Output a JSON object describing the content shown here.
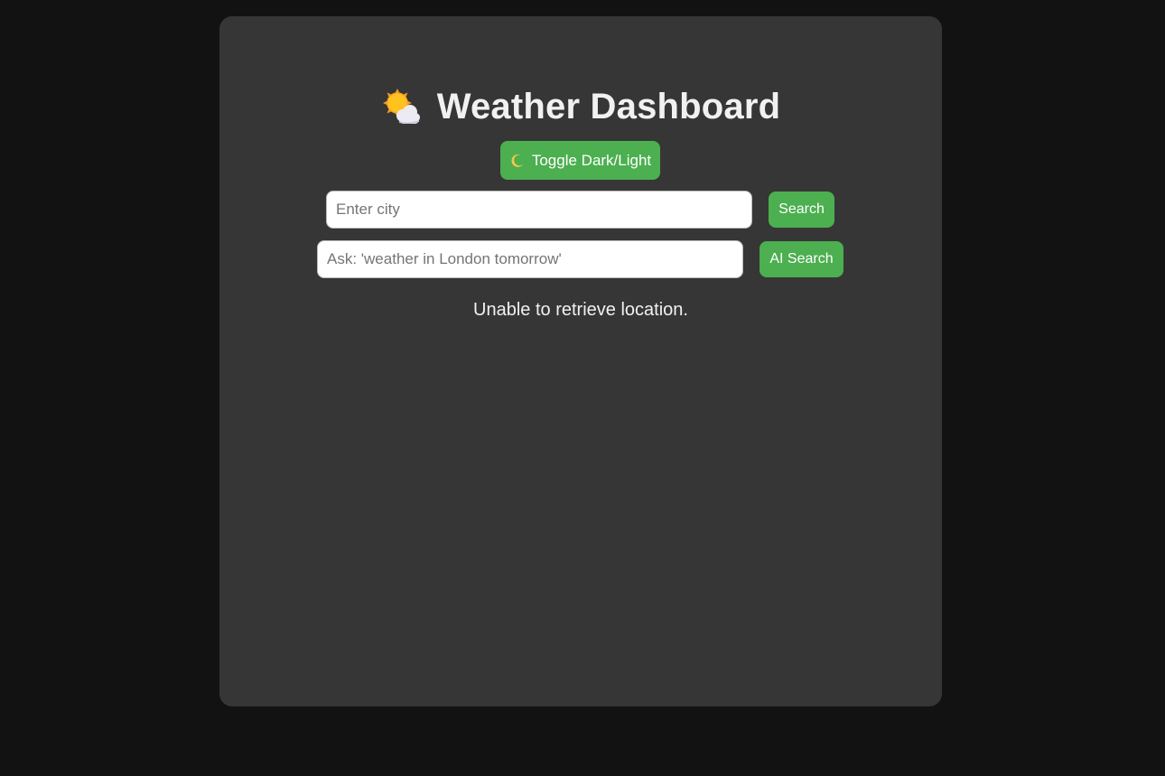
{
  "header": {
    "title": "Weather Dashboard",
    "icon": "sun-behind-cloud-icon"
  },
  "theme_toggle": {
    "label": "Toggle Dark/Light",
    "icon": "crescent-moon-icon"
  },
  "city_search": {
    "placeholder": "Enter city",
    "value": "",
    "button_label": "Search"
  },
  "ai_search": {
    "placeholder": "Ask: 'weather in London tomorrow'",
    "value": "",
    "button_label": "AI Search"
  },
  "status": {
    "message": "Unable to retrieve location."
  },
  "colors": {
    "page_background": "#121212",
    "card_background": "#363636",
    "accent": "#4caf50",
    "text": "#f1f1f1"
  }
}
